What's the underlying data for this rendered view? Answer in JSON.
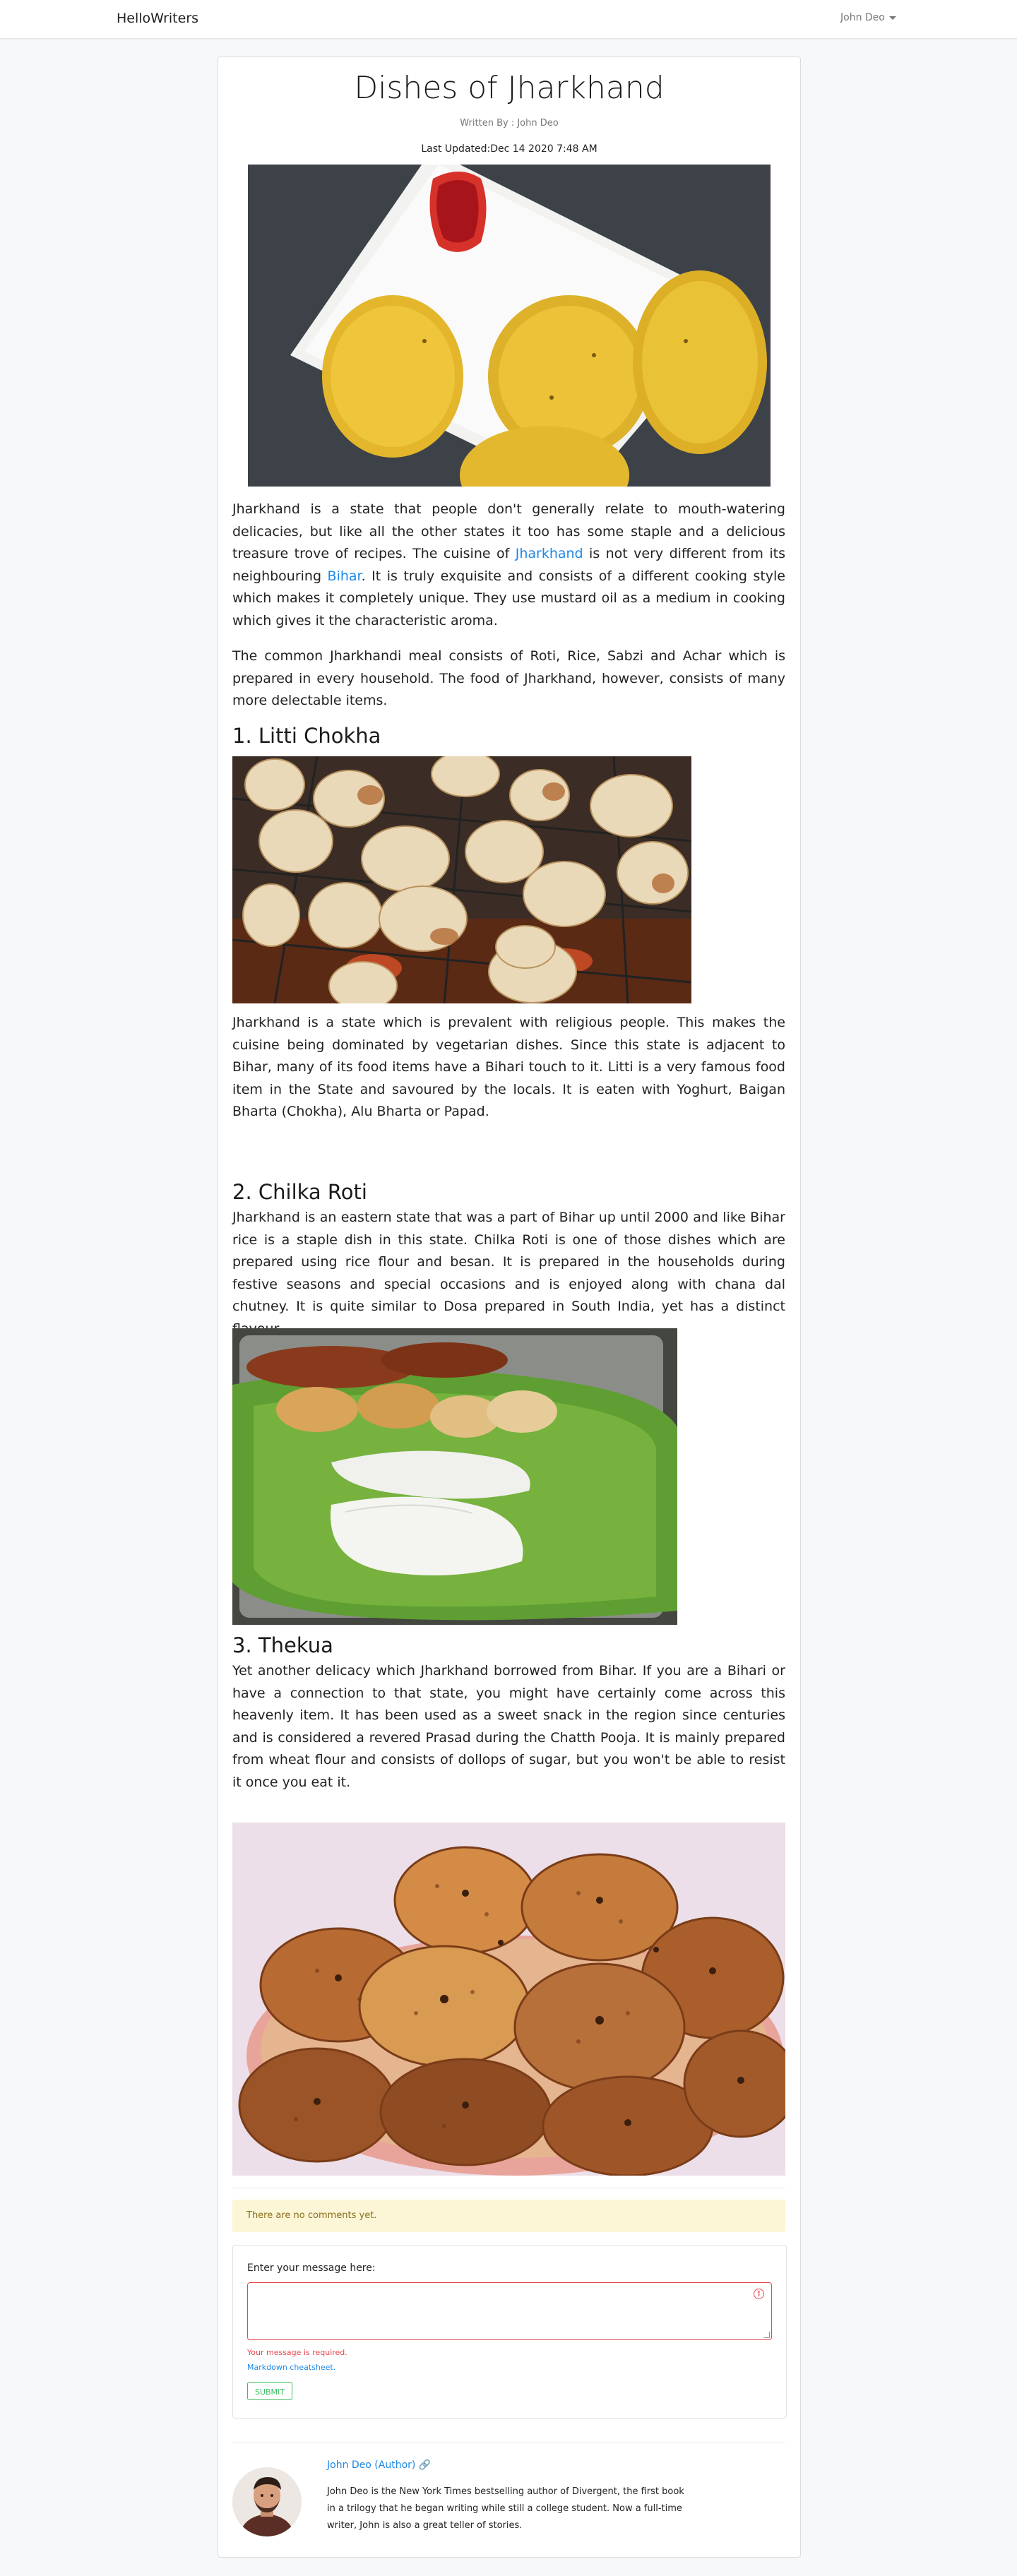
{
  "navbar": {
    "brand": "HelloWriters",
    "user": "John Deo"
  },
  "article": {
    "title": "Dishes of Jharkhand",
    "byline": "Written By : John Deo",
    "updated": "Last Updated:Dec 14 2020 7:48 AM",
    "intro_p1_before": "Jharkhand is a state that people don't generally relate to mouth-watering delicacies, but like all the other states it too has some staple and a delicious treasure trove of recipes. The cuisine of ",
    "intro_p1_link1": "Jharkhand",
    "intro_p1_middle": " is not very different from its neighbouring ",
    "intro_p1_link2": "Bihar",
    "intro_p1_after": ". It is truly exquisite and consists of a different cooking style which makes it completely unique. They use mustard oil as a medium in cooking which gives it the characteristic aroma.",
    "intro_p2": "The common Jharkhandi meal consists of Roti, Rice, Sabzi and Achar which is prepared in every household. The food of Jharkhand, however, consists of many more delectable items.",
    "section1_heading": "1. Litti Chokha",
    "section1_text": "Jharkhand is a state which is prevalent with religious people. This makes the cuisine being dominated by vegetarian dishes. Since this state is adjacent to Bihar, many of its food items have a Bihari touch to it. Litti is a very famous food item in the State and savoured by the locals. It is eaten with Yoghurt, Baigan Bharta (Chokha), Alu Bharta or Papad.",
    "section2_heading": "2. Chilka Roti",
    "section2_text": "Jharkhand is an eastern state that was a part of Bihar up until 2000 and like Bihar rice is a staple dish in this state. Chilka Roti is one of those dishes which are prepared using rice flour and besan. It is prepared in the households during festive seasons and special occasions and is enjoyed along with chana dal chutney. It is quite similar to Dosa prepared in South India, yet has a distinct flavour.",
    "section3_heading": "3. Thekua",
    "section3_text": "Yet another delicacy which Jharkhand borrowed from Bihar. If you are a Bihari or have a connection to that state, you might have certainly come across this heavenly item. It has been used as a sweet snack in the region since centuries and is considered a revered Prasad during the Chatth Pooja. It is mainly prepared from wheat flour and consists of dollops of sugar, but you won't be able to resist it once you eat it."
  },
  "comments": {
    "empty_notice": "There are no comments yet.",
    "label": "Enter your message here:",
    "error": "Your message is required.",
    "markdown_link": "Markdown cheatsheet.",
    "submit": "SUBMIT"
  },
  "author": {
    "name": "John Deo (Author)",
    "bio": "John Deo is the New York Times bestselling author of Divergent, the first book in a trilogy that he began writing while still a college student. Now a full-time writer, John is also a great teller of stories."
  },
  "colors": {
    "link": "#1e88e5",
    "error": "#e5484d",
    "success": "#3dbb5f",
    "notice_bg": "#fcf6d6"
  },
  "icons": {
    "dropdown": "caret-down-icon",
    "error": "exclamation-circle-icon",
    "author_link": "link-icon"
  }
}
